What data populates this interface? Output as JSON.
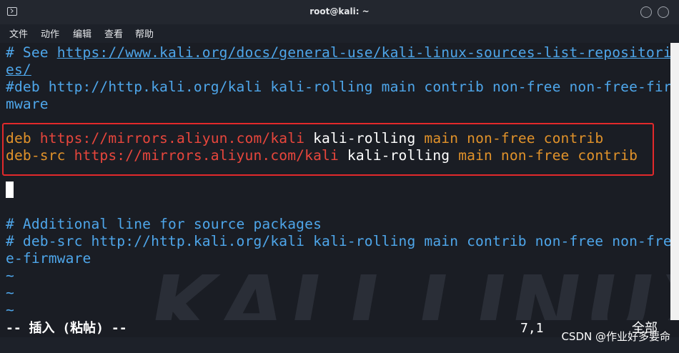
{
  "window": {
    "title": "root@kali: ~"
  },
  "menu": {
    "items": [
      "文件",
      "动作",
      "编辑",
      "查看",
      "帮助"
    ]
  },
  "editor": {
    "lines": {
      "l1_prefix": "# See ",
      "l1_url": "https://www.kali.org/docs/general-use/kali-linux-sources-list-repositori",
      "l2_url": "es/",
      "l3": "#deb http://http.kali.org/kali kali-rolling main contrib non-free non-free-fir",
      "l4": "mware",
      "l5_deb": "deb",
      "l5_url": "https://mirrors.aliyun.com/kali",
      "l5_suite": "kali-rolling",
      "l5_comps": "main non-free contrib",
      "l6_deb": "deb-src",
      "l6_url": "https://mirrors.aliyun.com/kali",
      "l6_suite": "kali-rolling",
      "l6_comps": "main non-free contrib",
      "l8": "# Additional line for source packages",
      "l9": "# deb-src http://http.kali.org/kali kali-rolling main contrib non-free non-fre",
      "l10": "e-firmware",
      "tilde": "~"
    },
    "watermark": "KALI LINUX"
  },
  "status": {
    "mode": "-- 插入 (粘帖) --",
    "position": "7,1",
    "scope": "全部"
  },
  "footer": {
    "csdn": "CSDN @作业好多要命"
  },
  "colors": {
    "comment": "#4ea6ea",
    "keyword": "#e1922a",
    "url_red": "#e8463c",
    "highlight_border": "#e2292b",
    "background": "#1a1d24"
  }
}
